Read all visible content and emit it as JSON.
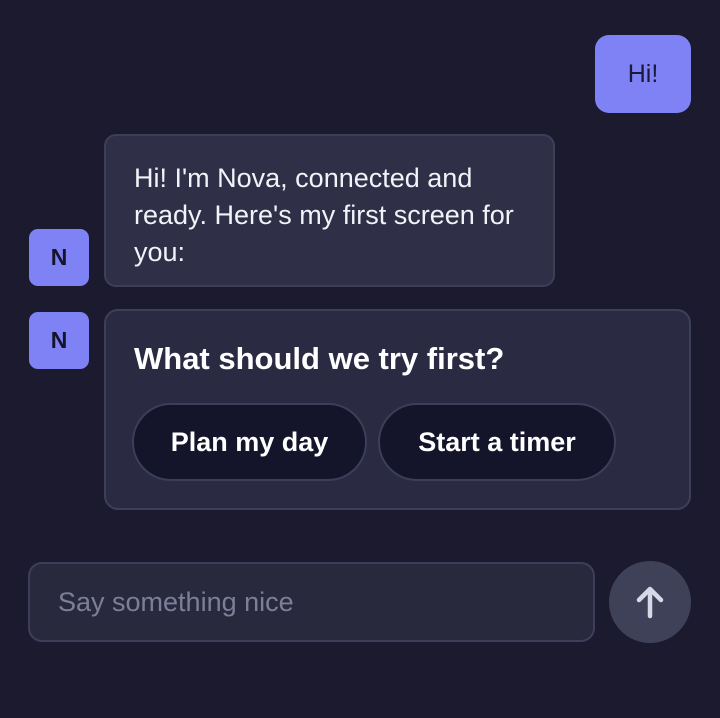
{
  "colors": {
    "background": "#1b1a2e",
    "accent": "#7f82f5",
    "bubble": "#2f3047",
    "card": "#2a2b43",
    "chip": "#14142a",
    "border": "#3d3f5a",
    "send_button": "#3f4159",
    "placeholder": "#7d7f99"
  },
  "messages": {
    "user": {
      "text": "Hi!"
    },
    "bot_text": {
      "avatar_letter": "N",
      "text": "Hi! I'm Nova, connected and ready. Here's my first screen for you:"
    },
    "bot_card": {
      "avatar_letter": "N",
      "title": "What should we try first?",
      "options": [
        {
          "label": "Plan my day"
        },
        {
          "label": "Start a timer"
        }
      ]
    }
  },
  "composer": {
    "value": "",
    "placeholder": "Say something nice",
    "send_icon": "arrow-up-icon"
  }
}
